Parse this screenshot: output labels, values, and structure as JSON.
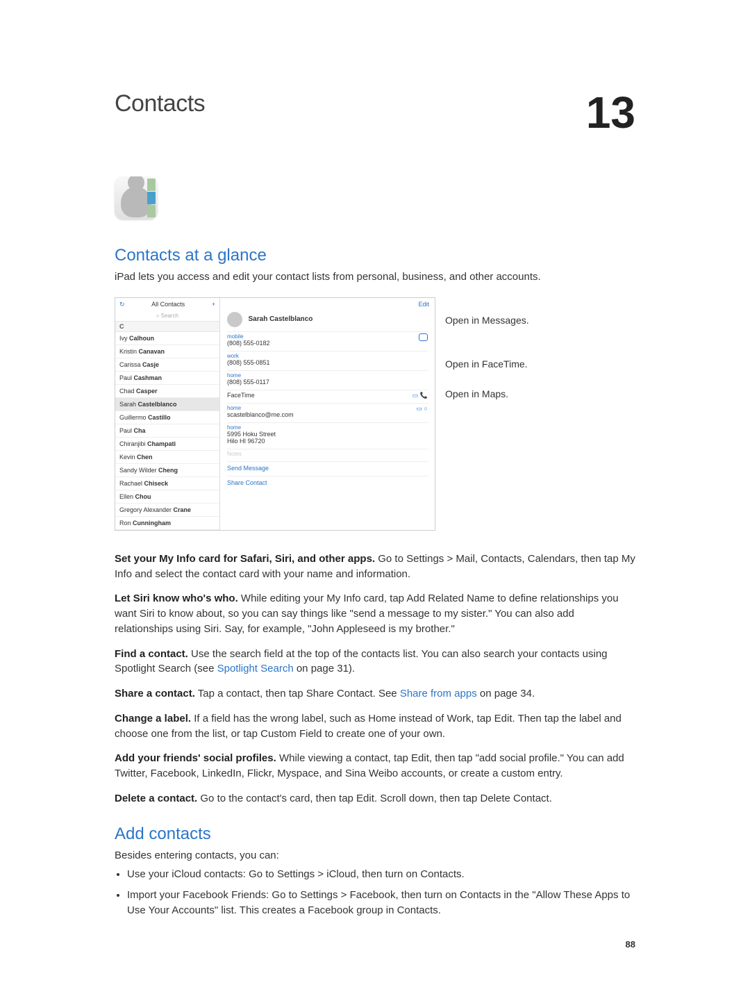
{
  "chapter": {
    "title": "Contacts",
    "number": "13",
    "page_number": "88"
  },
  "section1": {
    "heading": "Contacts at a glance",
    "intro": "iPad lets you access and edit your contact lists from personal, business, and other accounts."
  },
  "screenshot": {
    "left_header": {
      "refresh": "↻",
      "title": "All Contacts",
      "add": "+"
    },
    "search_placeholder": "⌕ Search",
    "section_letter": "C",
    "contacts": [
      "Ivy Calhoun",
      "Kristin Canavan",
      "Carissa Casje",
      "Paul Cashman",
      "Chad Casper",
      "Sarah Castelblanco",
      "Guillermo Castillo",
      "Paul Cha",
      "Chiranjibi Champati",
      "Kevin Chen",
      "Sandy Wilder Cheng",
      "Rachael Chiseck",
      "Ellen Chou",
      "Gregory Alexander Crane",
      "Ron Cunningham"
    ],
    "selected_index": 5,
    "detail": {
      "edit": "Edit",
      "name": "Sarah Castelblanco",
      "fields": [
        {
          "label": "mobile",
          "value": "(808) 555-0182"
        },
        {
          "label": "work",
          "value": "(808) 555-0851"
        },
        {
          "label": "home",
          "value": "(808) 555-0117"
        }
      ],
      "facetime_label": "FaceTime",
      "facetime_icons": "▭  📞",
      "email_label": "home",
      "email_value": "scastelblanco@me.com",
      "email_icons": "▭  ○",
      "address_label": "home",
      "address_line1": "5995 Hoku Street",
      "address_line2": "Hilo HI 96720",
      "notes_label": "Notes",
      "action1": "Send Message",
      "action2": "Share Contact"
    }
  },
  "callouts": {
    "messages": "Open in Messages.",
    "facetime": "Open in FaceTime.",
    "maps": "Open in Maps."
  },
  "paragraphs": {
    "p1_strong": "Set your My Info card for Safari, Siri, and other apps.",
    "p1_rest": " Go to Settings > Mail, Contacts, Calendars, then tap My Info and select the contact card with your name and information.",
    "p2_strong": "Let Siri know who's who.",
    "p2_rest": " While editing your My Info card, tap Add Related Name to define relationships you want Siri to know about, so you can say things like \"send a message to my sister.\" You can also add relationships using Siri. Say, for example, \"John Appleseed is my brother.\"",
    "p3_strong": "Find a contact.",
    "p3_rest_a": " Use the search field at the top of the contacts list. You can also search your contacts using Spotlight Search (see ",
    "p3_link": "Spotlight Search",
    "p3_rest_b": " on page 31).",
    "p4_strong": "Share a contact.",
    "p4_rest_a": " Tap a contact, then tap Share Contact. See ",
    "p4_link": "Share from apps",
    "p4_rest_b": " on page 34.",
    "p5_strong": "Change a label.",
    "p5_rest": " If a field has the wrong label, such as Home instead of Work, tap Edit. Then tap the label and choose one from the list, or tap Custom Field to create one of your own.",
    "p6_strong": "Add your friends' social profiles.",
    "p6_rest": " While viewing a contact, tap Edit, then tap \"add social profile.\" You can add Twitter, Facebook, LinkedIn, Flickr, Myspace, and Sina Weibo accounts, or create a custom entry.",
    "p7_strong": "Delete a contact.",
    "p7_rest": " Go to the contact's card, then tap Edit. Scroll down, then tap Delete Contact."
  },
  "section2": {
    "heading": "Add contacts",
    "intro": "Besides entering contacts, you can:",
    "bullets": [
      {
        "lead": "Use your iCloud contacts:",
        "rest": "  Go to Settings > iCloud, then turn on Contacts."
      },
      {
        "lead": "Import your Facebook Friends:",
        "rest": "  Go to Settings > Facebook, then turn on Contacts in the \"Allow These Apps to Use Your Accounts\" list. This creates a Facebook group in Contacts."
      }
    ]
  }
}
